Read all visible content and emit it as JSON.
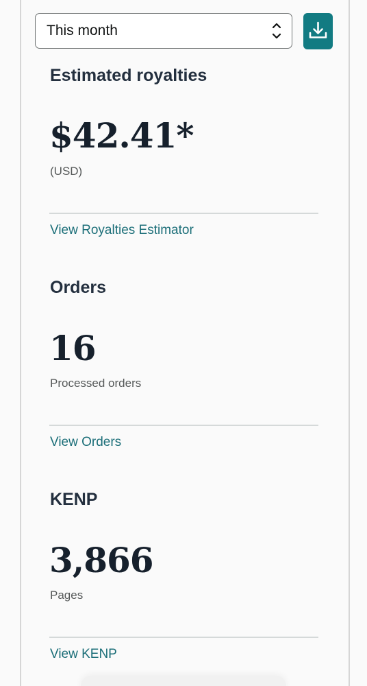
{
  "filter": {
    "selected": "This month",
    "chevron_icon": "chevron-up-down-icon",
    "download_icon": "download-icon"
  },
  "royalties": {
    "heading": "Estimated royalties",
    "value": "$42.41*",
    "caption": "(USD)",
    "link": "View Royalties Estimator"
  },
  "orders": {
    "heading": "Orders",
    "value": "16",
    "caption": "Processed orders",
    "link": "View Orders"
  },
  "kenp": {
    "heading": "KENP",
    "value": "3,866",
    "caption": "Pages",
    "link": "View KENP"
  },
  "colors": {
    "accent": "#127b82",
    "link": "#1b6e78",
    "text": "#232f3e"
  }
}
